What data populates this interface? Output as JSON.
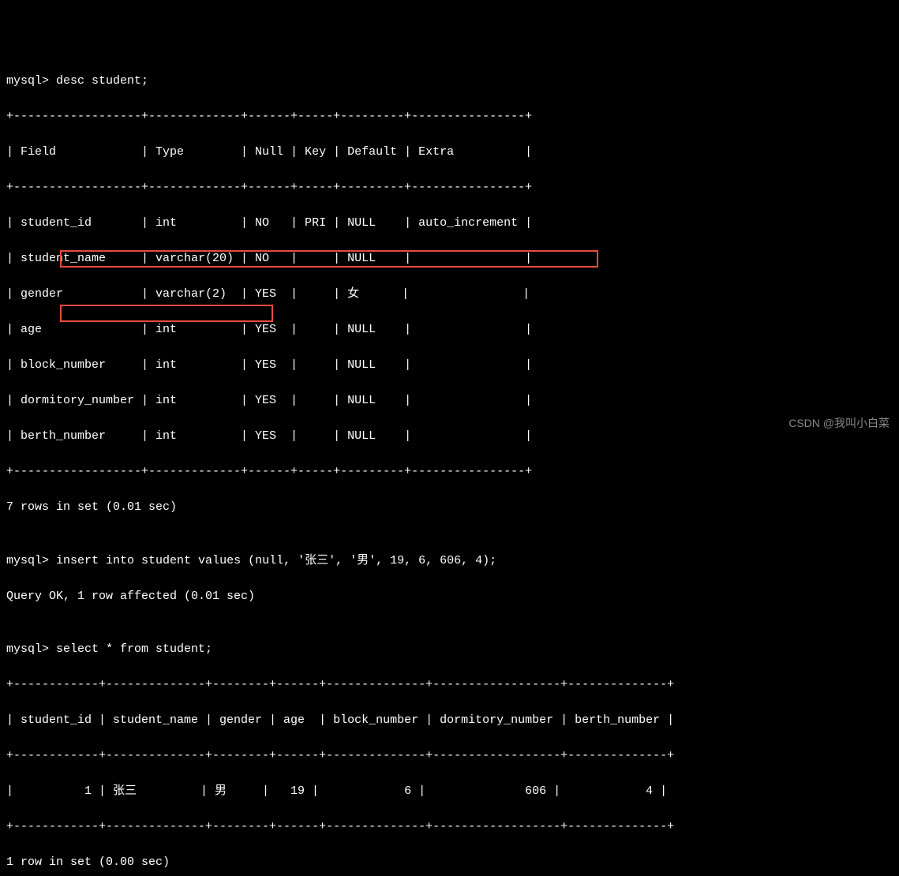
{
  "prompt": "mysql>",
  "cmd_desc": "desc student;",
  "desc_table": {
    "border_top": "+------------------+-------------+------+-----+---------+----------------+",
    "header_row": "| Field            | Type        | Null | Key | Default | Extra          |",
    "border_mid": "+------------------+-------------+------+-----+---------+----------------+",
    "rows": [
      "| student_id       | int         | NO   | PRI | NULL    | auto_increment |",
      "| student_name     | varchar(20) | NO   |     | NULL    |                |",
      "| gender           | varchar(2)  | YES  |     | 女      |                |",
      "| age              | int         | YES  |     | NULL    |                |",
      "| block_number     | int         | YES  |     | NULL    |                |",
      "| dormitory_number | int         | YES  |     | NULL    |                |",
      "| berth_number     | int         | YES  |     | NULL    |                |"
    ],
    "border_bot": "+------------------+-------------+------+-----+---------+----------------+"
  },
  "desc_footer": "7 rows in set (0.01 sec)",
  "blank": "",
  "cmd_insert": "insert into student values (null, '张三', '男', 19, 6, 606, 4);",
  "insert_result": "Query OK, 1 row affected (0.01 sec)",
  "cmd_select": "select * from student;",
  "select_table": {
    "border_top": "+------------+--------------+--------+------+--------------+------------------+--------------+",
    "header_row": "| student_id | student_name | gender | age  | block_number | dormitory_number | berth_number |",
    "border_mid": "+------------+--------------+--------+------+--------------+------------------+--------------+",
    "rows": [
      "|          1 | 张三         | 男     |   19 |            6 |              606 |            4 |"
    ],
    "border_bot": "+------------+--------------+--------+------+--------------+------------------+--------------+"
  },
  "select_footer": "1 row in set (0.00 sec)",
  "watermark": "CSDN @我叫小白菜"
}
